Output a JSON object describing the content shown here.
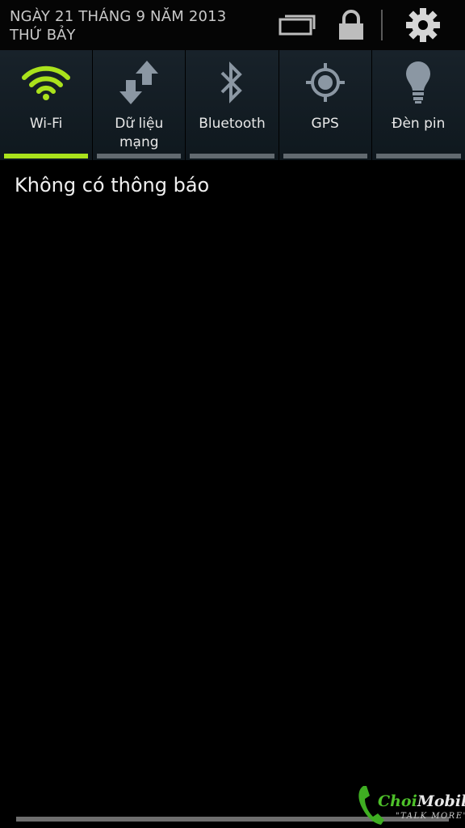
{
  "status_header": {
    "date": "NGÀY 21 THÁNG 9 NĂM 2013",
    "weekday": "THỨ BẢY",
    "icons": [
      "multi-window-icon",
      "lock-icon",
      "gear-icon"
    ]
  },
  "quick_toggles": [
    {
      "label": "Wi-Fi",
      "icon": "wifi-icon",
      "active": true
    },
    {
      "label": "Dữ liệu\nmạng",
      "icon": "mobile-data-icon",
      "active": false
    },
    {
      "label": "Bluetooth",
      "icon": "bluetooth-icon",
      "active": false
    },
    {
      "label": "GPS",
      "icon": "gps-icon",
      "active": false
    },
    {
      "label": "Đèn pin",
      "icon": "flashlight-icon",
      "active": false
    }
  ],
  "notifications": {
    "empty_text": "Không có thông báo"
  },
  "watermark": {
    "brand_prefix": "Choi",
    "brand_suffix": "Mobile",
    "tagline": "\"TALK MORE\""
  },
  "colors": {
    "active_accent": "#aae21c",
    "inactive_bar": "#626a70",
    "icon_inactive": "#8b97a3"
  }
}
